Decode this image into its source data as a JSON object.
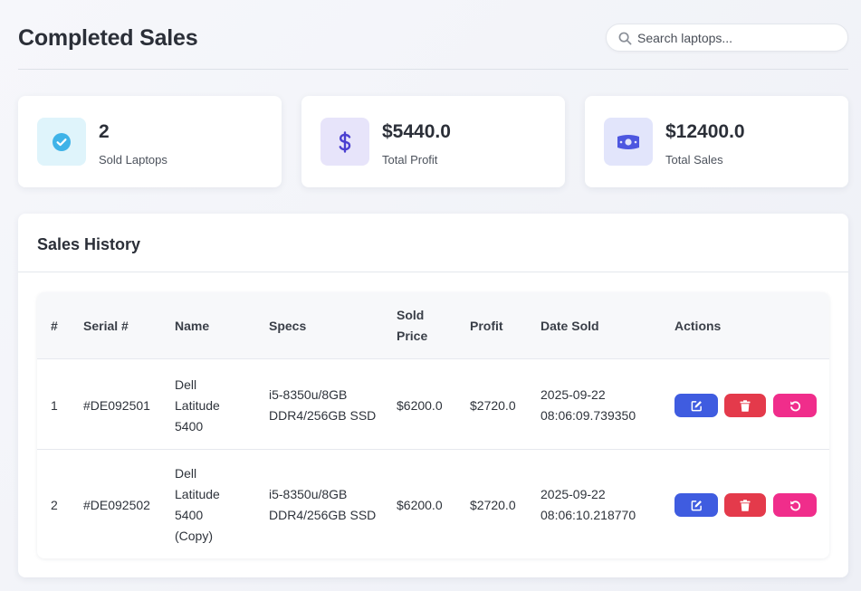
{
  "header": {
    "title": "Completed Sales",
    "search_placeholder": "Search laptops..."
  },
  "stats": [
    {
      "value": "2",
      "label": "Sold Laptops",
      "icon": "check-circle-icon",
      "icon_color": "#3fb3e8",
      "icon_bg": "#dff4fb"
    },
    {
      "value": "$5440.0",
      "label": "Total Profit",
      "icon": "dollar-icon",
      "icon_color": "#4a3fd0",
      "icon_bg": "#e7e4fa"
    },
    {
      "value": "$12400.0",
      "label": "Total Sales",
      "icon": "money-bill-icon",
      "icon_color": "#4d57e0",
      "icon_bg": "#e2e5fb"
    }
  ],
  "history": {
    "title": "Sales History",
    "columns": {
      "num": "#",
      "serial": "Serial #",
      "name": "Name",
      "specs": "Specs",
      "price_1": "Sold",
      "price_2": "Price",
      "profit": "Profit",
      "date": "Date Sold",
      "actions": "Actions"
    },
    "rows": [
      {
        "num": "1",
        "serial": "#DE092501",
        "name_lines": [
          "Dell",
          "Latitude",
          "5400"
        ],
        "specs_lines": [
          "i5-8350u/8GB",
          "DDR4/256GB SSD"
        ],
        "price": "$6200.0",
        "profit": "$2720.0",
        "date_lines": [
          "2025-09-22",
          "08:06:09.739350"
        ]
      },
      {
        "num": "2",
        "serial": "#DE092502",
        "name_lines": [
          "Dell",
          "Latitude",
          "5400",
          "(Copy)"
        ],
        "specs_lines": [
          "i5-8350u/8GB",
          "DDR4/256GB SSD"
        ],
        "price": "$6200.0",
        "profit": "$2720.0",
        "date_lines": [
          "2025-09-22",
          "08:06:10.218770"
        ]
      }
    ],
    "action_icons": [
      "edit-icon",
      "trash-icon",
      "undo-icon"
    ],
    "action_colors": {
      "edit": "#3f5ce0",
      "delete": "#e43a4b",
      "restore": "#f02d8b"
    }
  }
}
